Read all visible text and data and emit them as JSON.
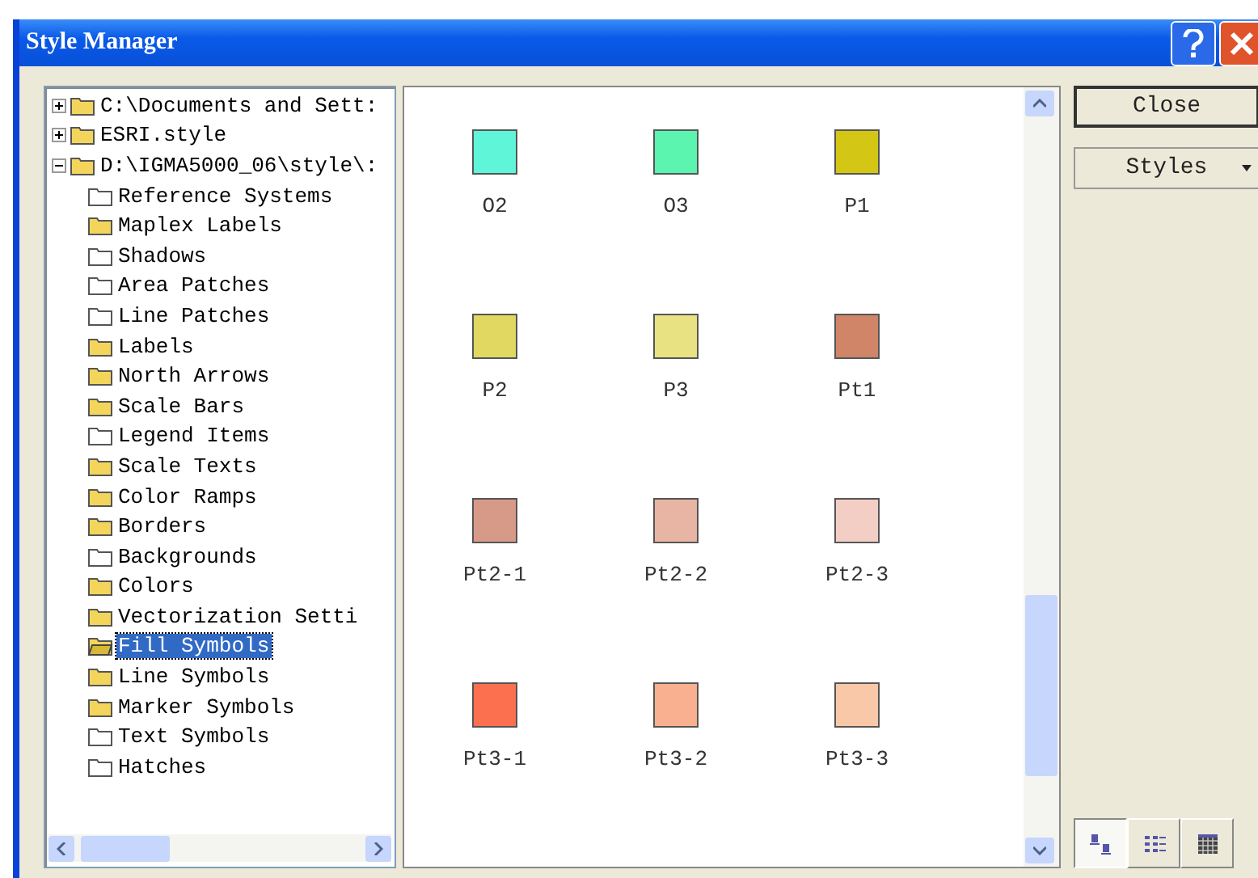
{
  "window": {
    "title": "Style Manager"
  },
  "tree": [
    {
      "label": "C:\\Documents and Sett:",
      "expanded": false,
      "filled": true,
      "selected": false
    },
    {
      "label": "ESRI.style",
      "expanded": false,
      "filled": true,
      "selected": false
    },
    {
      "label": "D:\\IGMA5000_06\\style\\:",
      "expanded": true,
      "filled": true,
      "selected": false,
      "children": [
        {
          "label": "Reference Systems",
          "filled": false,
          "selected": false
        },
        {
          "label": "Maplex Labels",
          "filled": true,
          "selected": false
        },
        {
          "label": "Shadows",
          "filled": false,
          "selected": false
        },
        {
          "label": "Area Patches",
          "filled": false,
          "selected": false
        },
        {
          "label": "Line Patches",
          "filled": false,
          "selected": false
        },
        {
          "label": "Labels",
          "filled": true,
          "selected": false
        },
        {
          "label": "North Arrows",
          "filled": true,
          "selected": false
        },
        {
          "label": "Scale Bars",
          "filled": true,
          "selected": false
        },
        {
          "label": "Legend Items",
          "filled": false,
          "selected": false
        },
        {
          "label": "Scale Texts",
          "filled": true,
          "selected": false
        },
        {
          "label": "Color Ramps",
          "filled": true,
          "selected": false
        },
        {
          "label": "Borders",
          "filled": true,
          "selected": false
        },
        {
          "label": "Backgrounds",
          "filled": false,
          "selected": false
        },
        {
          "label": "Colors",
          "filled": true,
          "selected": false
        },
        {
          "label": "Vectorization Setti",
          "filled": true,
          "selected": false
        },
        {
          "label": "Fill Symbols",
          "filled": true,
          "selected": true
        },
        {
          "label": "Line Symbols",
          "filled": true,
          "selected": false
        },
        {
          "label": "Marker Symbols",
          "filled": true,
          "selected": false
        },
        {
          "label": "Text Symbols",
          "filled": false,
          "selected": false
        },
        {
          "label": "Hatches",
          "filled": false,
          "selected": false
        }
      ]
    }
  ],
  "symbols": [
    {
      "label": "O2",
      "color": "#5ef5d8"
    },
    {
      "label": "O3",
      "color": "#5cf5b0"
    },
    {
      "label": "P1",
      "color": "#d4c614"
    },
    {
      "label": "P2",
      "color": "#e0d860"
    },
    {
      "label": "P3",
      "color": "#e8e282"
    },
    {
      "label": "Pt1",
      "color": "#d08468"
    },
    {
      "label": "Pt2-1",
      "color": "#d89a88"
    },
    {
      "label": "Pt2-2",
      "color": "#e8b4a4"
    },
    {
      "label": "Pt2-3",
      "color": "#f2cec4"
    },
    {
      "label": "Pt3-1",
      "color": "#fc7050"
    },
    {
      "label": "Pt3-2",
      "color": "#f8b090"
    },
    {
      "label": "Pt3-3",
      "color": "#f8c8a8"
    }
  ],
  "buttons": [
    {
      "label": "Close",
      "kind": "default"
    },
    {
      "label": "Styles",
      "kind": "menu"
    }
  ],
  "views": [
    {
      "kind": "icons",
      "selected": true
    },
    {
      "kind": "list",
      "selected": false
    },
    {
      "kind": "report",
      "selected": false
    }
  ]
}
